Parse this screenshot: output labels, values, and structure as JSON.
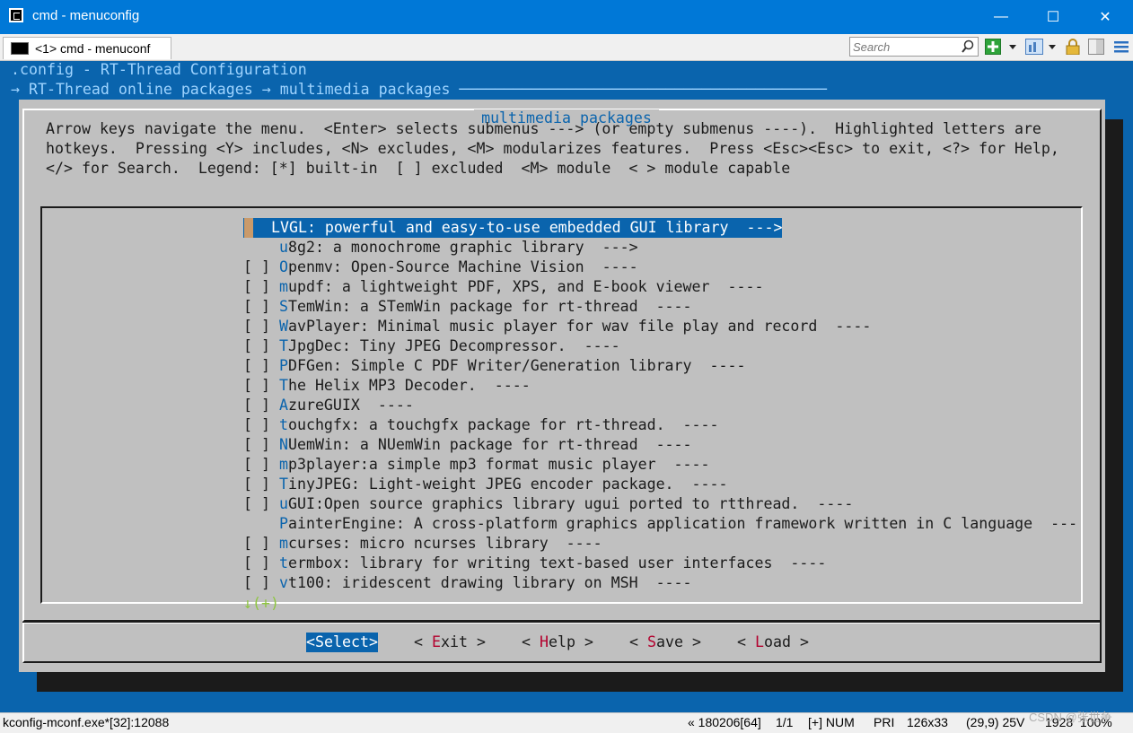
{
  "window": {
    "title": "cmd - menuconfig",
    "minimize_glyph": "—",
    "maximize_glyph": "☐",
    "close_glyph": "✕"
  },
  "tabbar": {
    "tab_label": "<1> cmd - menuconf",
    "search_placeholder": "Search"
  },
  "console": {
    "line1": ".config - RT-Thread Configuration",
    "line2": "→ RT-Thread online packages → multimedia packages ─────────────────────────────────────────"
  },
  "dialog": {
    "title": "multimedia packages",
    "help": [
      "Arrow keys navigate the menu.  <Enter> selects submenus ---> (or empty submenus ----).  Highlighted letters are",
      "hotkeys.  Pressing <Y> includes, <N> excludes, <M> modularizes features.  Press <Esc><Esc> to exit, <?> for Help,",
      "</> for Search.  Legend: [*] built-in  [ ] excluded  <M> module  < > module capable"
    ],
    "items": [
      {
        "prefix": "    ",
        "hotkey": "L",
        "rest": "VGL: powerful and easy-to-use embedded GUI library  --->",
        "selected": true
      },
      {
        "prefix": "    ",
        "hotkey": "u",
        "rest": "8g2: a monochrome graphic library  --->"
      },
      {
        "prefix": "[ ] ",
        "hotkey": "O",
        "rest": "penmv: Open-Source Machine Vision  ----"
      },
      {
        "prefix": "[ ] ",
        "hotkey": "m",
        "rest": "updf: a lightweight PDF, XPS, and E-book viewer  ----"
      },
      {
        "prefix": "[ ] ",
        "hotkey": "S",
        "rest": "TemWin: a STemWin package for rt-thread  ----"
      },
      {
        "prefix": "[ ] ",
        "hotkey": "W",
        "rest": "avPlayer: Minimal music player for wav file play and record  ----"
      },
      {
        "prefix": "[ ] ",
        "hotkey": "T",
        "rest": "JpgDec: Tiny JPEG Decompressor.  ----"
      },
      {
        "prefix": "[ ] ",
        "hotkey": "P",
        "rest": "DFGen: Simple C PDF Writer/Generation library  ----"
      },
      {
        "prefix": "[ ] ",
        "hotkey": "T",
        "rest": "he Helix MP3 Decoder.  ----"
      },
      {
        "prefix": "[ ] ",
        "hotkey": "A",
        "rest": "zureGUIX  ----"
      },
      {
        "prefix": "[ ] ",
        "hotkey": "t",
        "rest": "ouchgfx: a touchgfx package for rt-thread.  ----"
      },
      {
        "prefix": "[ ] ",
        "hotkey": "N",
        "rest": "UemWin: a NUemWin package for rt-thread  ----"
      },
      {
        "prefix": "[ ] ",
        "hotkey": "m",
        "rest": "p3player:a simple mp3 format music player  ----"
      },
      {
        "prefix": "[ ] ",
        "hotkey": "T",
        "rest": "inyJPEG: Light-weight JPEG encoder package.  ----"
      },
      {
        "prefix": "[ ] ",
        "hotkey": "u",
        "rest": "GUI:Open source graphics library ugui ported to rtthread.  ----"
      },
      {
        "prefix": "    ",
        "hotkey": "P",
        "rest": "ainterEngine: A cross-platform graphics application framework written in C language  ---"
      },
      {
        "prefix": "[ ] ",
        "hotkey": "m",
        "rest": "curses: micro ncurses library  ----"
      },
      {
        "prefix": "[ ] ",
        "hotkey": "t",
        "rest": "ermbox: library for writing text-based user interfaces  ----"
      },
      {
        "prefix": "[ ] ",
        "hotkey": "v",
        "rest": "t100: iridescent drawing library on MSH  ----"
      }
    ],
    "more_indicator": "↓(+)",
    "buttons": [
      {
        "pre": "<",
        "hotkey": "",
        "label": "Select",
        "post": ">",
        "selected": true
      },
      {
        "pre": "< ",
        "hotkey": "E",
        "label": "xit",
        "post": " >"
      },
      {
        "pre": "< ",
        "hotkey": "H",
        "label": "elp",
        "post": " >"
      },
      {
        "pre": "< ",
        "hotkey": "S",
        "label": "ave",
        "post": " >"
      },
      {
        "pre": "< ",
        "hotkey": "L",
        "label": "oad",
        "post": " >"
      }
    ]
  },
  "status": {
    "process": "kconfig-mconf.exe*[32]:12088",
    "encoding": "« 180206[64]",
    "page": "1/1",
    "ins": "[+] NUM",
    "pri": "PRI",
    "size": "126x33",
    "pos": "(29,9) 25V",
    "zoom": "1928  100%",
    "watermark": "CSDN @张世争"
  },
  "colors": {
    "console_bg": "#0a64ad",
    "dialog_bg": "#c0c0c0",
    "hotkey": "#0a64ad",
    "button_hotkey": "#b3002d"
  }
}
